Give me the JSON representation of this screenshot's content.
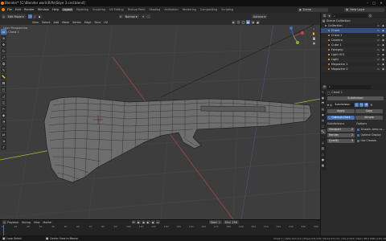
{
  "window": {
    "title": "Blender* [C:\\Blender work\\Rifle\\Skye 3.cnd.blend]",
    "minimize": "–",
    "maximize": "□",
    "close": "✕"
  },
  "menu": {
    "items": [
      "File",
      "Edit",
      "Render",
      "Window",
      "Help"
    ],
    "workspaces": [
      "Layout",
      "Modeling",
      "Sculpting",
      "UV Editing",
      "Texture Paint",
      "Shading",
      "Animation",
      "Rendering",
      "Compositing",
      "Scripting"
    ],
    "active_workspace": "Layout",
    "scene_label": "Scene",
    "view_layer_label": "View Layer"
  },
  "viewport_header": {
    "mode": "Edit Mode",
    "orientation": "Normal",
    "menus": [
      "View",
      "Select",
      "Add",
      "Mesh",
      "Vertex",
      "Edge",
      "Face",
      "UV"
    ],
    "options_label": "Options"
  },
  "viewport": {
    "view_name": "User Perspective",
    "object_name": "(0) Chest 1"
  },
  "timeline": {
    "menus": [
      "Playback",
      "Keying",
      "View",
      "Marker"
    ],
    "frame_numbers": [
      "0",
      "10",
      "20",
      "30",
      "40",
      "50",
      "60",
      "70",
      "80",
      "90",
      "100",
      "110",
      "120",
      "130",
      "140",
      "150",
      "160",
      "170",
      "180",
      "190",
      "200",
      "210",
      "220",
      "230",
      "240",
      "250"
    ],
    "start_label": "Start",
    "start_value": "1",
    "end_label": "End",
    "end_value": "250"
  },
  "statusbar": {
    "left": "Loop Select",
    "middle": "Center View to Mouse",
    "right": "Chest 1 | Verts 0/2,112 | Edges 0/4,218 | Faces 0/2,111 | Tris 4,224 | Mem: 88.0 MiB | 2.81.16"
  },
  "outliner": {
    "root": "Scene Collection",
    "items": [
      {
        "label": "Collection",
        "color": "#9a9a9a",
        "selected": false
      },
      {
        "label": "Chest",
        "color": "#e69138",
        "selected": true
      },
      {
        "label": "Chest 1",
        "color": "#e69138",
        "selected": false
      },
      {
        "label": "Camera",
        "color": "#c5a25a",
        "selected": false
      },
      {
        "label": "Cube 1",
        "color": "#e69138",
        "selected": false
      },
      {
        "label": "Foregrip",
        "color": "#e69138",
        "selected": false
      },
      {
        "label": "Light 001",
        "color": "#e0c341",
        "selected": false
      },
      {
        "label": "Light",
        "color": "#e0c341",
        "selected": false
      },
      {
        "label": "Magazine 1",
        "color": "#e69138",
        "selected": false
      },
      {
        "label": "Magazine 2",
        "color": "#e69138",
        "selected": false
      }
    ]
  },
  "properties": {
    "object": "Chest 1",
    "panel": "Subdivision",
    "modifier_name": "Subdivision",
    "apply_label": "Apply",
    "copy_label": "Copy",
    "algorithm_a": "Catmull-Clark",
    "algorithm_b": "Simple",
    "subdivisions_label": "Subdivisions",
    "options_label": "Options",
    "viewport_label": "Viewport",
    "viewport_value": "2",
    "render_label": "Render",
    "render_value": "2",
    "quality_label": "Quality",
    "quality_value": "3",
    "opt1": "Smooth, keep co...",
    "opt2": "Optimal Display",
    "opt3": "Use Creases"
  }
}
